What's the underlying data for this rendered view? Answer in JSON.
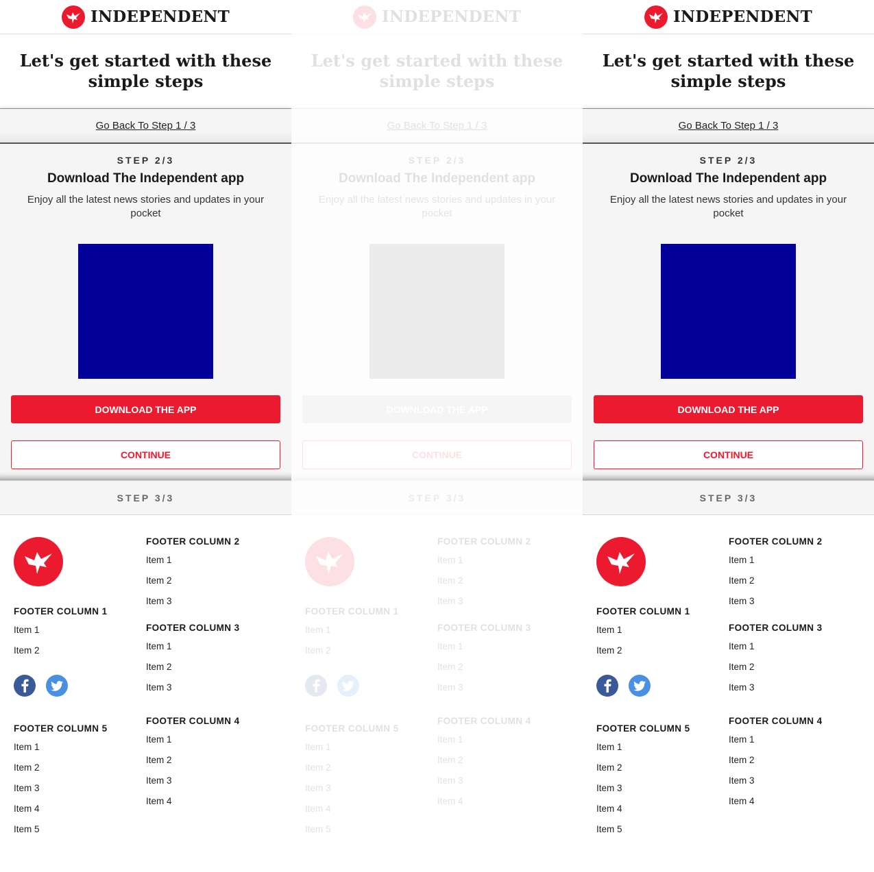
{
  "brand": {
    "name": "INDEPENDENT",
    "accent_color": "#ec1a2e",
    "app_image_color": "#030099"
  },
  "page_title": "Let's get started with these simple steps",
  "back_link": "Go Back To Step 1 / 3",
  "step2": {
    "label": "STEP 2/3",
    "title": "Download The Independent app",
    "description": "Enjoy all the latest news stories and updates in your pocket",
    "download_button": "DOWNLOAD THE APP",
    "continue_button": "CONTINUE"
  },
  "step3": {
    "label": "STEP 3/3"
  },
  "footer": {
    "col1": {
      "heading": "FOOTER COLUMN 1",
      "items": [
        "Item 1",
        "Item 2"
      ]
    },
    "col2": {
      "heading": "FOOTER COLUMN 2",
      "items": [
        "Item 1",
        "Item 2",
        "Item 3"
      ]
    },
    "col3": {
      "heading": "FOOTER COLUMN 3",
      "items": [
        "Item 1",
        "Item 2",
        "Item 3"
      ]
    },
    "col4": {
      "heading": "FOOTER COLUMN 4",
      "items": [
        "Item 1",
        "Item 2",
        "Item 3",
        "Item 4"
      ]
    },
    "col5": {
      "heading": "FOOTER COLUMN 5",
      "items": [
        "Item 1",
        "Item 2",
        "Item 3",
        "Item 4",
        "Item 5"
      ]
    },
    "social": [
      "facebook-icon",
      "twitter-icon"
    ]
  },
  "panels": [
    {
      "state": "normal"
    },
    {
      "state": "faded"
    },
    {
      "state": "normal"
    }
  ]
}
